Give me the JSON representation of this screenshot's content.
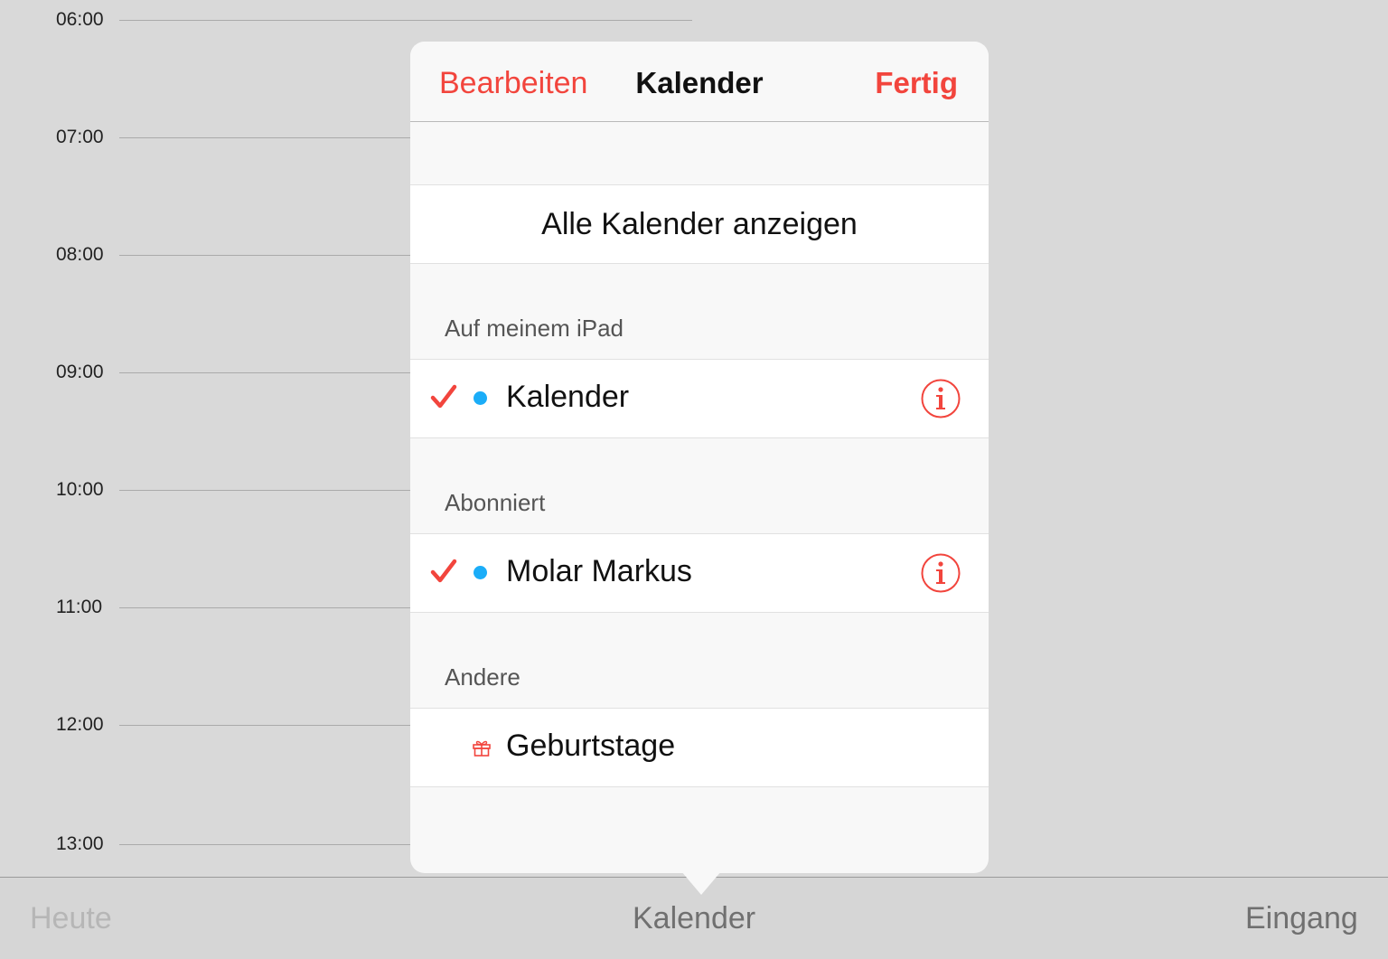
{
  "day_view": {
    "hours": [
      "06:00",
      "07:00",
      "08:00",
      "09:00",
      "10:00",
      "11:00",
      "12:00",
      "13:00"
    ]
  },
  "popover": {
    "nav": {
      "edit_label": "Bearbeiten",
      "title": "Kalender",
      "done_label": "Fertig"
    },
    "show_all_label": "Alle Kalender anzeigen",
    "sections": [
      {
        "header": "Auf meinem iPad",
        "items": [
          {
            "label": "Kalender",
            "checked": true,
            "color": "#1badf8",
            "icon": "info-icon"
          }
        ]
      },
      {
        "header": "Abonniert",
        "items": [
          {
            "label": "Molar Markus",
            "checked": true,
            "color": "#1badf8",
            "icon": "info-icon"
          }
        ]
      },
      {
        "header": "Andere",
        "items": [
          {
            "label": "Geburtstage",
            "checked": false,
            "icon": "gift-icon"
          }
        ]
      }
    ],
    "accent_color": "#f2453d"
  },
  "toolbar": {
    "today_label": "Heute",
    "calendars_label": "Kalender",
    "inbox_label": "Eingang"
  }
}
